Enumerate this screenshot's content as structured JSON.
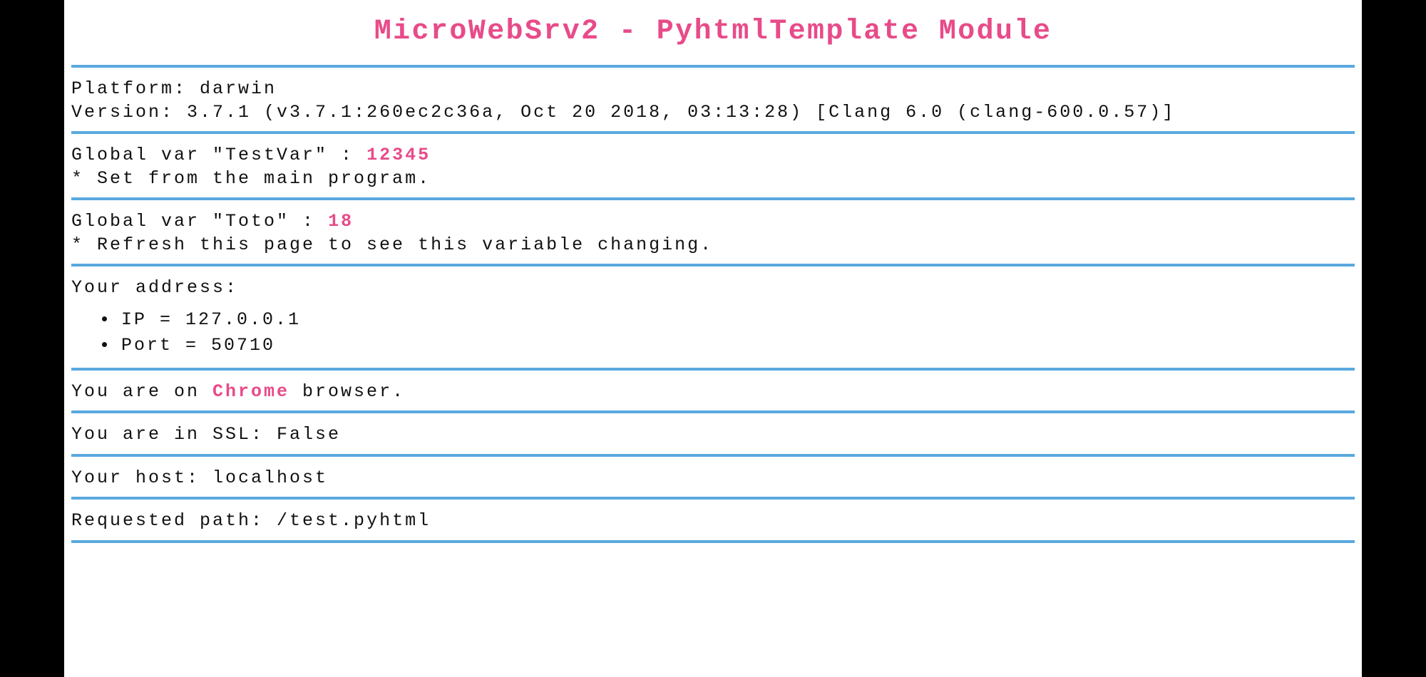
{
  "title": "MicroWebSrv2 - PyhtmlTemplate Module",
  "platform": {
    "label": "Platform: ",
    "value": "darwin"
  },
  "version": {
    "label": "Version: ",
    "value": "3.7.1 (v3.7.1:260ec2c36a, Oct 20 2018, 03:13:28) [Clang 6.0 (clang-600.0.57)]"
  },
  "testvar": {
    "label_pre": "Global var \"TestVar\" : ",
    "value": "12345",
    "note": "* Set from the main program."
  },
  "toto": {
    "label_pre": "Global var \"Toto\" : ",
    "value": "18",
    "note": "* Refresh this page to see this variable changing."
  },
  "address": {
    "heading": "Your address:",
    "ip_label": "IP = ",
    "ip_value": "127.0.0.1",
    "port_label": "Port = ",
    "port_value": "50710"
  },
  "browser": {
    "pre": "You are on ",
    "name": "Chrome",
    "post": " browser."
  },
  "ssl": {
    "label": "You are in SSL: ",
    "value": "False"
  },
  "host": {
    "label": "Your host: ",
    "value": "localhost"
  },
  "path": {
    "label": "Requested path: ",
    "value": "/test.pyhtml"
  }
}
